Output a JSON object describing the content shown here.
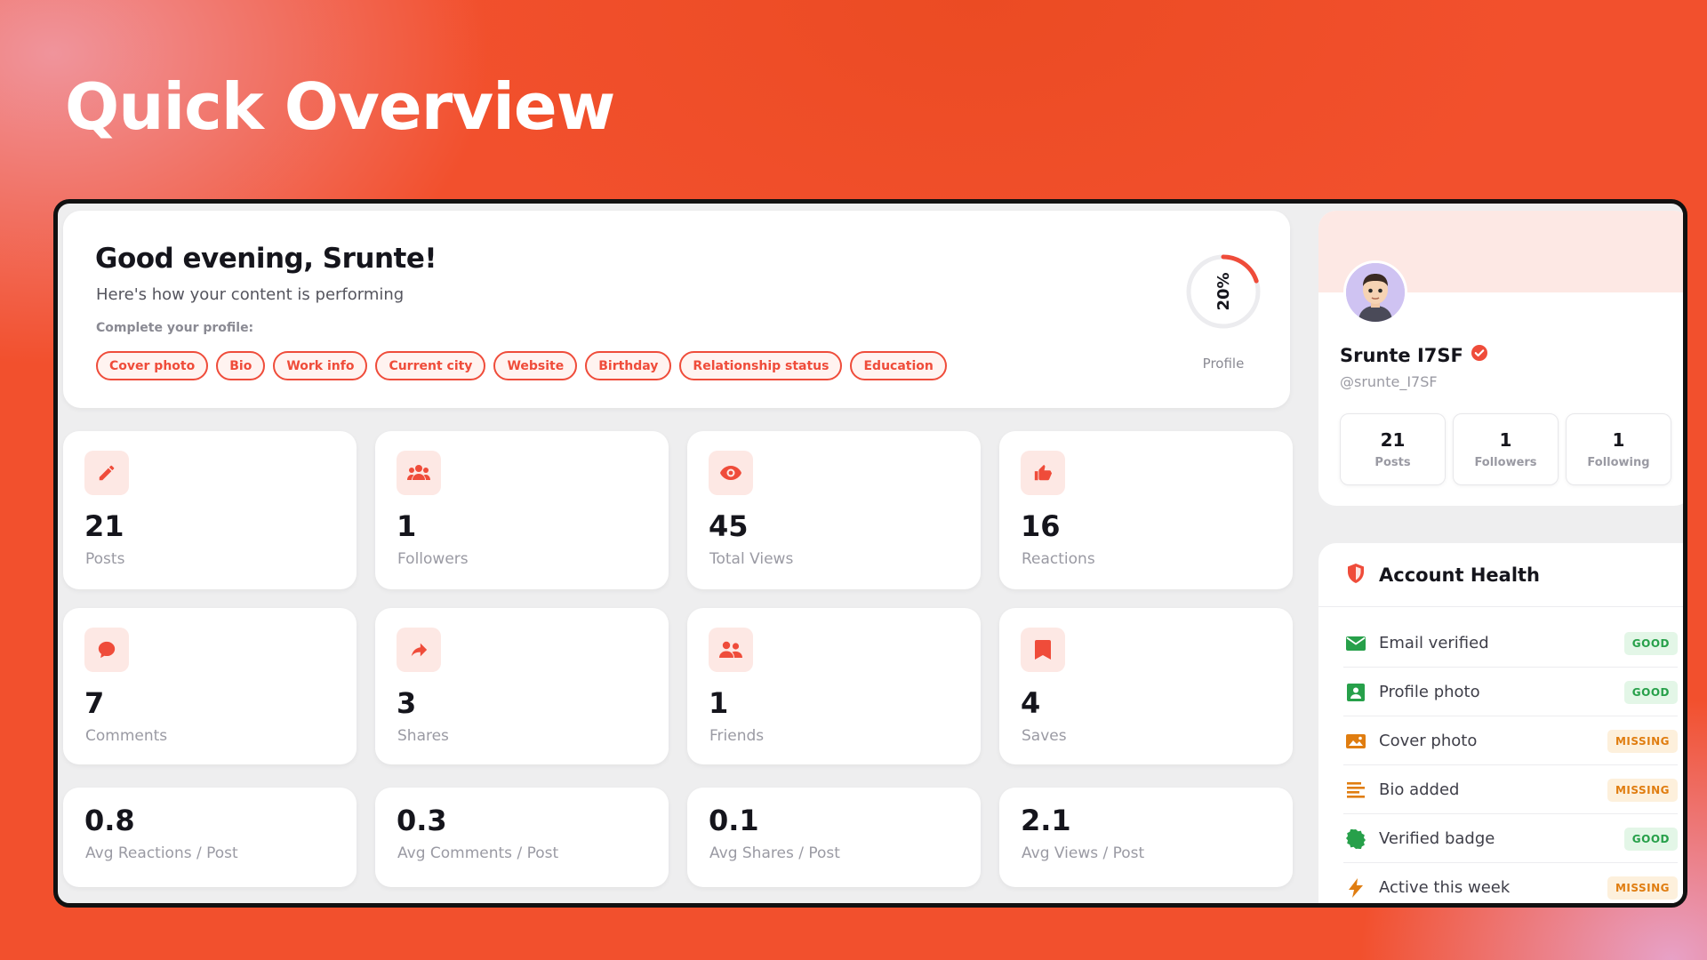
{
  "page": {
    "title": "Quick Overview"
  },
  "greeting": {
    "title": "Good evening, Srunte!",
    "subtitle": "Here's how your content is performing",
    "complete_label": "Complete your profile:",
    "chips": [
      "Cover photo",
      "Bio",
      "Work info",
      "Current city",
      "Website",
      "Birthday",
      "Relationship status",
      "Education"
    ],
    "progress": {
      "value_text": "20%",
      "percent": 20,
      "label": "Profile"
    }
  },
  "stats": [
    {
      "icon": "pencil-icon",
      "value": "21",
      "label": "Posts"
    },
    {
      "icon": "users-icon",
      "value": "1",
      "label": "Followers"
    },
    {
      "icon": "eye-icon",
      "value": "45",
      "label": "Total Views"
    },
    {
      "icon": "thumbs-up-icon",
      "value": "16",
      "label": "Reactions"
    },
    {
      "icon": "comment-icon",
      "value": "7",
      "label": "Comments"
    },
    {
      "icon": "share-icon",
      "value": "3",
      "label": "Shares"
    },
    {
      "icon": "friends-icon",
      "value": "1",
      "label": "Friends"
    },
    {
      "icon": "bookmark-icon",
      "value": "4",
      "label": "Saves"
    }
  ],
  "averages": [
    {
      "value": "0.8",
      "label": "Avg Reactions / Post"
    },
    {
      "value": "0.3",
      "label": "Avg Comments / Post"
    },
    {
      "value": "0.1",
      "label": "Avg Shares / Post"
    },
    {
      "value": "2.1",
      "label": "Avg Views / Post"
    }
  ],
  "profile": {
    "name": "Srunte I7SF",
    "handle": "@srunte_I7SF",
    "stats": [
      {
        "value": "21",
        "label": "Posts"
      },
      {
        "value": "1",
        "label": "Followers"
      },
      {
        "value": "1",
        "label": "Following"
      }
    ]
  },
  "health": {
    "title": "Account Health",
    "items": [
      {
        "icon": "envelope-icon",
        "label": "Email verified",
        "status": "GOOD",
        "color": "#27a04a"
      },
      {
        "icon": "image-icon",
        "label": "Profile photo",
        "status": "GOOD",
        "color": "#27a04a"
      },
      {
        "icon": "broken-image-icon",
        "label": "Cover photo",
        "status": "MISSING",
        "color": "#e07d10"
      },
      {
        "icon": "text-lines-icon",
        "label": "Bio added",
        "status": "MISSING",
        "color": "#e07d10"
      },
      {
        "icon": "verified-seal-icon",
        "label": "Verified badge",
        "status": "GOOD",
        "color": "#27a04a"
      },
      {
        "icon": "lightning-icon",
        "label": "Active this week",
        "status": "MISSING",
        "color": "#e07d10"
      }
    ]
  },
  "colors": {
    "accent": "#ef4c3a",
    "good": "#27a04a",
    "missing": "#e07d10"
  }
}
